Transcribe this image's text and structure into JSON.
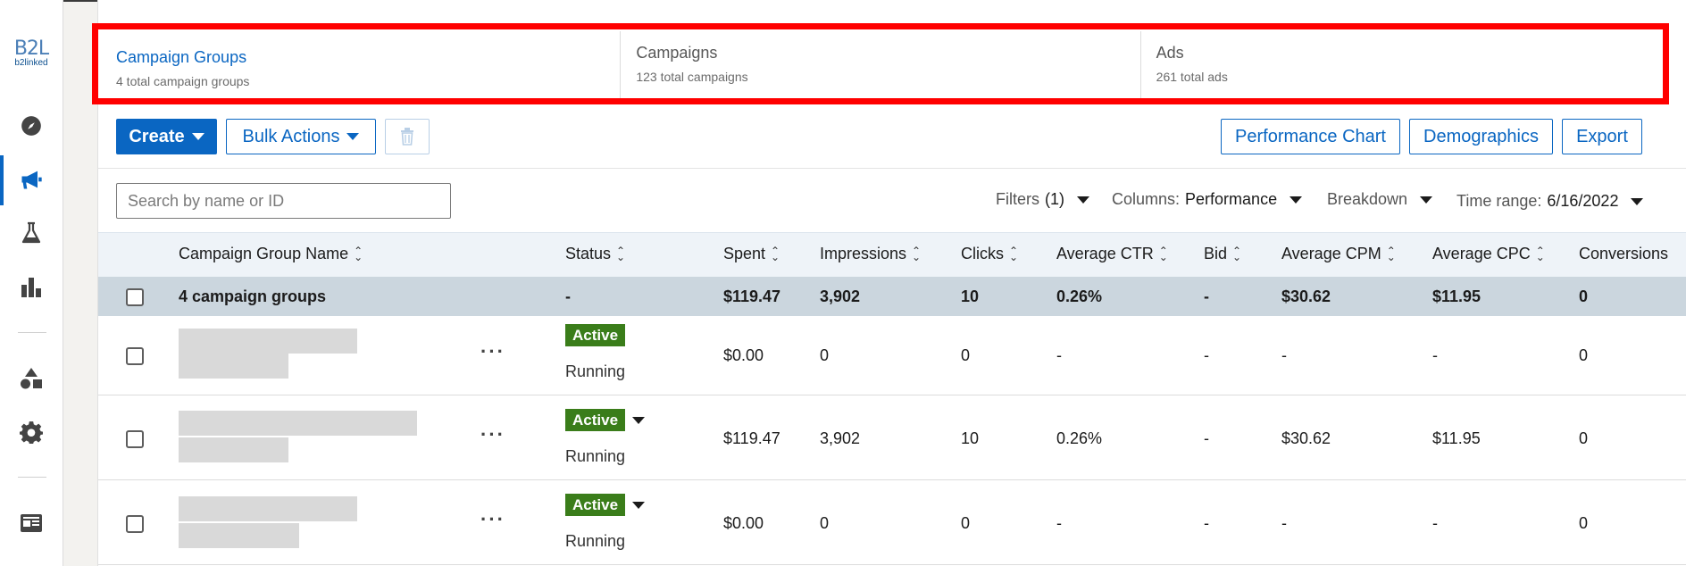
{
  "logo": {
    "big": "B2L",
    "small": "b2linked"
  },
  "rail": {
    "icons": [
      "compass-icon",
      "megaphone-icon",
      "flask-icon",
      "bar-chart-icon",
      "shapes-icon",
      "gear-icon",
      "id-card-icon"
    ],
    "active": "megaphone-icon"
  },
  "tabs": [
    {
      "title": "Campaign Groups",
      "subtitle": "4 total campaign groups",
      "active": true
    },
    {
      "title": "Campaigns",
      "subtitle": "123 total campaigns",
      "active": false
    },
    {
      "title": "Ads",
      "subtitle": "261 total ads",
      "active": false
    }
  ],
  "toolbar": {
    "create": "Create",
    "bulk_actions": "Bulk Actions",
    "delete_icon": "trash-icon",
    "performance_chart": "Performance Chart",
    "demographics": "Demographics",
    "export": "Export"
  },
  "search": {
    "placeholder": "Search by name or ID",
    "value": ""
  },
  "filters": {
    "filters_label": "Filters",
    "filters_count": "(1)",
    "columns_label": "Columns:",
    "columns_value": "Performance",
    "breakdown_label": "Breakdown",
    "time_range_label": "Time range:",
    "time_range_value": "6/16/2022"
  },
  "table": {
    "headers": {
      "name": "Campaign Group Name",
      "status": "Status",
      "spent": "Spent",
      "impressions": "Impressions",
      "clicks": "Clicks",
      "avg_ctr": "Average CTR",
      "bid": "Bid",
      "avg_cpm": "Average CPM",
      "avg_cpc": "Average CPC",
      "conversions": "Conversions"
    },
    "total": {
      "name": "4 campaign groups",
      "status": "-",
      "spent": "$119.47",
      "impressions": "3,902",
      "clicks": "10",
      "avg_ctr": "0.26%",
      "bid": "-",
      "avg_cpm": "$30.62",
      "avg_cpc": "$11.95",
      "conversions": "0"
    },
    "rows": [
      {
        "status_badge": "Active",
        "status_text": "Running",
        "has_dropdown": false,
        "spent": "$0.00",
        "impressions": "0",
        "clicks": "0",
        "avg_ctr": "-",
        "bid": "-",
        "avg_cpm": "-",
        "avg_cpc": "-",
        "conversions": "0"
      },
      {
        "status_badge": "Active",
        "status_text": "Running",
        "has_dropdown": true,
        "spent": "$119.47",
        "impressions": "3,902",
        "clicks": "10",
        "avg_ctr": "0.26%",
        "bid": "-",
        "avg_cpm": "$30.62",
        "avg_cpc": "$11.95",
        "conversions": "0"
      },
      {
        "status_badge": "Active",
        "status_text": "Running",
        "has_dropdown": true,
        "spent": "$0.00",
        "impressions": "0",
        "clicks": "0",
        "avg_ctr": "-",
        "bid": "-",
        "avg_cpm": "-",
        "avg_cpc": "-",
        "conversions": "0"
      }
    ],
    "more_actions_glyph": "···"
  },
  "colors": {
    "accent": "#0a66c2",
    "highlight": "#ff0000",
    "active_badge": "#3a7d1a"
  }
}
